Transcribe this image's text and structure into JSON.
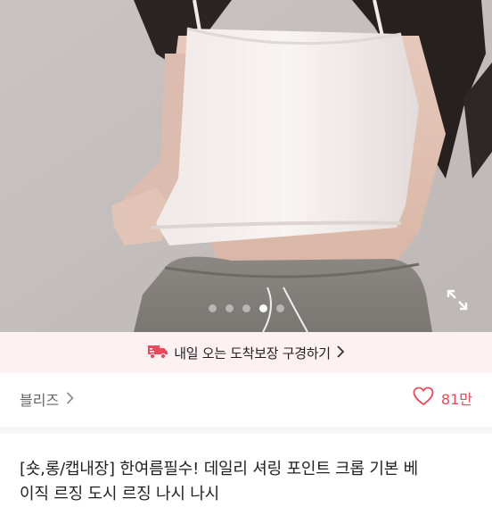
{
  "product_image": {
    "carousel_total": 5,
    "carousel_active": 4,
    "expand_icon": "expand-icon"
  },
  "delivery_banner": {
    "text": "내일 오는 도착보장 구경하기",
    "icon": "truck-icon",
    "chevron": "chevron-right-icon",
    "accent_color": "#ea4a5a"
  },
  "shop": {
    "name": "블리즈",
    "chevron": "chevron-right-icon"
  },
  "likes": {
    "icon": "heart-icon",
    "count": "81만"
  },
  "product": {
    "title_line1": "[숏,롱/캡내장] 한여름필수! 데일리 셔링 포인트 크롭 기본 베",
    "title_line2": "이직 르징 도시 르징 나시 나시"
  }
}
